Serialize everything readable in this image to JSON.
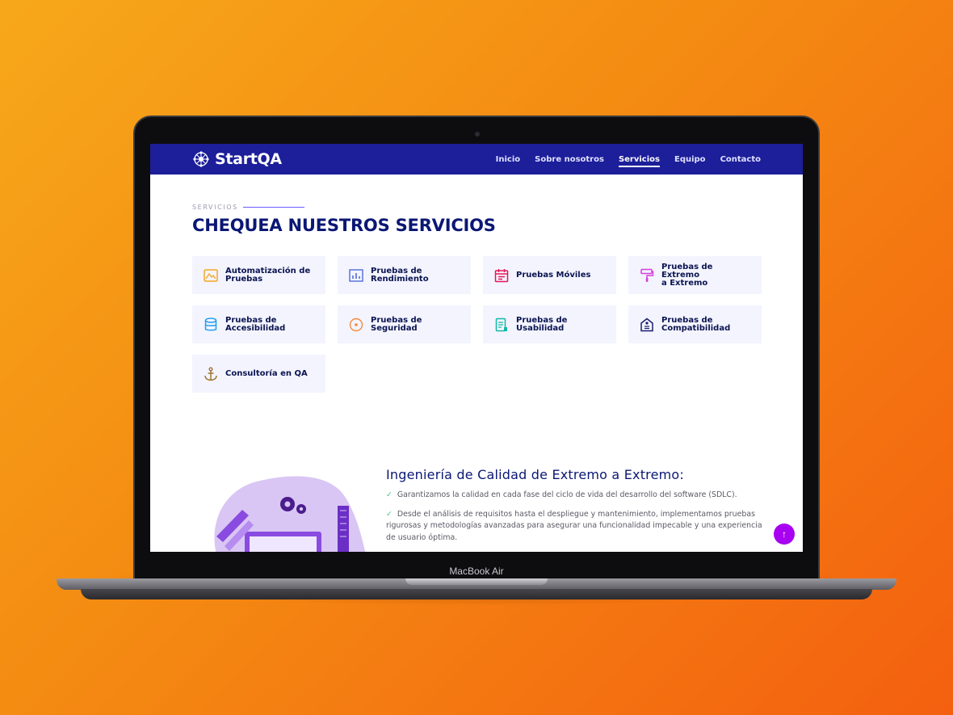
{
  "device": {
    "label": "MacBook Air"
  },
  "brand": {
    "name": "StartQA",
    "logo_icon": "network-globe-icon"
  },
  "nav": {
    "items": [
      {
        "label": "Inicio",
        "active": false
      },
      {
        "label": "Sobre nosotros",
        "active": false
      },
      {
        "label": "Servicios",
        "active": true
      },
      {
        "label": "Equipo",
        "active": false
      },
      {
        "label": "Contacto",
        "active": false
      }
    ]
  },
  "services": {
    "eyebrow": "SERVICIOS",
    "title": "CHEQUEA NUESTROS SERVICIOS",
    "cards": [
      {
        "line1": "Automatización de",
        "line2": "Pruebas",
        "icon": "image-frame-icon",
        "color": "#f5a623"
      },
      {
        "line1": "Pruebas de",
        "line2": "Rendimiento",
        "icon": "bar-chart-icon",
        "color": "#4f6dd8"
      },
      {
        "line1": "Pruebas Móviles",
        "line2": "",
        "icon": "calendar-icon",
        "color": "#e4165a"
      },
      {
        "line1": "Pruebas de Extremo",
        "line2": "a Extremo",
        "icon": "paint-roller-icon",
        "color": "#d63ce0"
      },
      {
        "line1": "Pruebas de",
        "line2": "Accesibilidad",
        "icon": "database-icon",
        "color": "#1f9df0"
      },
      {
        "line1": "Pruebas de",
        "line2": "Seguridad",
        "icon": "target-icon",
        "color": "#f38a3a"
      },
      {
        "line1": "Pruebas de",
        "line2": "Usabilidad",
        "icon": "document-icon",
        "color": "#14b8a6"
      },
      {
        "line1": "Pruebas de",
        "line2": "Compatibilidad",
        "icon": "house-badge-icon",
        "color": "#1c1e6e"
      },
      {
        "line1": "Consultoría en QA",
        "line2": "",
        "icon": "anchor-icon",
        "color": "#a07433"
      }
    ]
  },
  "feature": {
    "title": "Ingeniería de Calidad de Extremo a Extremo:",
    "bullet1": "Garantizamos la calidad en cada fase del ciclo de vida del desarrollo del software (SDLC).",
    "bullet2": "Desde el análisis de requisitos hasta el despliegue y mantenimiento, implementamos pruebas rigurosas y metodologías avanzadas para asegurar una funcionalidad impecable y una experiencia de usuario óptima."
  },
  "scroll_top": {
    "icon": "arrow-up-icon"
  },
  "colors": {
    "navbar": "#1c1e9a",
    "title": "#0b1774",
    "card_bg": "#f3f4fe",
    "fab": "#a800f0"
  }
}
